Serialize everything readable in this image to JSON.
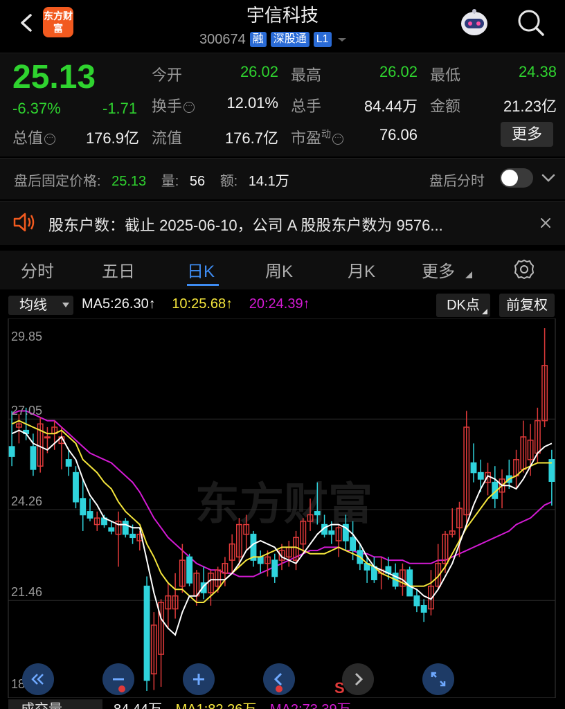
{
  "header": {
    "logo_text": "东方财富",
    "title": "宇信科技",
    "code": "300674",
    "tags": [
      "融",
      "深股通",
      "L1"
    ]
  },
  "quote": {
    "price": "25.13",
    "change_pct": "-6.37%",
    "change": "-1.71",
    "open_label": "今开",
    "open": "26.02",
    "high_label": "最高",
    "high": "26.02",
    "low_label": "最低",
    "low": "24.38",
    "turnover_label": "换手",
    "turnover": "12.01%",
    "volume_label": "总手",
    "volume": "84.44万",
    "amount_label": "金额",
    "amount": "21.23亿",
    "mktcap_label": "总值",
    "mktcap": "176.9亿",
    "float_label": "流值",
    "float_cap": "176.7亿",
    "pe_label": "市盈",
    "pe_sup": "动",
    "pe": "76.06",
    "more_label": "更多"
  },
  "after_hours": {
    "price_label": "盘后固定价格:",
    "price": "25.13",
    "vol_label": "量:",
    "vol": "56",
    "amt_label": "额:",
    "amt": "14.1万",
    "timeshare_label": "盘后分时"
  },
  "notice": {
    "text": "股东户数：截止 2025-06-10，公司 A 股股东户数为 9576..."
  },
  "tabs": [
    "分时",
    "五日",
    "日K",
    "周K",
    "月K",
    "更多"
  ],
  "active_tab": "日K",
  "chart_toolbar": {
    "indicator": "均线",
    "ma5": "MA5:26.30",
    "ma10": "10:25.68",
    "ma20": "20:24.39",
    "dk_label": "DK点",
    "adjust_label": "前复权"
  },
  "volume_strip": {
    "label": "成交量",
    "value": "84.44万",
    "ma1": "MA1:82.26万",
    "ma2": "MA2:73.39万"
  },
  "watermark": "东方财富",
  "colors": {
    "up": "#e03a3a",
    "down": "#2fd3dc",
    "ma5": "#ffffff",
    "ma10": "#f5e63c",
    "ma20": "#d41ad4",
    "accent": "#3e8cf2"
  },
  "chart_data": {
    "type": "candlestick",
    "y_ticks": [
      "29.85",
      "27.05",
      "24.26",
      "21.46",
      "18.67"
    ],
    "ylim": [
      18.67,
      29.85
    ],
    "sell_marker": "S",
    "candles": [
      {
        "o": 26.2,
        "h": 27.3,
        "l": 25.6,
        "c": 25.9
      },
      {
        "o": 26.8,
        "h": 27.2,
        "l": 26.3,
        "c": 26.9
      },
      {
        "o": 26.7,
        "h": 27.4,
        "l": 26.4,
        "c": 26.6
      },
      {
        "o": 26.2,
        "h": 26.6,
        "l": 25.3,
        "c": 25.5
      },
      {
        "o": 25.6,
        "h": 27.1,
        "l": 25.4,
        "c": 26.9
      },
      {
        "o": 26.5,
        "h": 26.8,
        "l": 26.0,
        "c": 26.5
      },
      {
        "o": 26.6,
        "h": 27.0,
        "l": 26.1,
        "c": 26.8
      },
      {
        "o": 26.3,
        "h": 26.8,
        "l": 25.5,
        "c": 26.5
      },
      {
        "o": 25.8,
        "h": 26.1,
        "l": 25.3,
        "c": 25.6
      },
      {
        "o": 25.4,
        "h": 25.6,
        "l": 24.3,
        "c": 24.5
      },
      {
        "o": 24.6,
        "h": 25.2,
        "l": 23.6,
        "c": 24.1
      },
      {
        "o": 24.2,
        "h": 24.6,
        "l": 23.9,
        "c": 24.0
      },
      {
        "o": 23.8,
        "h": 24.2,
        "l": 23.6,
        "c": 24.0
      },
      {
        "o": 24.0,
        "h": 24.1,
        "l": 23.7,
        "c": 23.8
      },
      {
        "o": 23.7,
        "h": 23.9,
        "l": 23.5,
        "c": 23.6
      },
      {
        "o": 23.5,
        "h": 24.2,
        "l": 22.5,
        "c": 23.9
      },
      {
        "o": 23.9,
        "h": 24.0,
        "l": 23.4,
        "c": 23.5
      },
      {
        "o": 23.5,
        "h": 23.8,
        "l": 23.2,
        "c": 23.4
      },
      {
        "o": 23.3,
        "h": 23.6,
        "l": 23.0,
        "c": 23.5
      },
      {
        "o": 21.9,
        "h": 22.2,
        "l": 18.67,
        "c": 19.0
      },
      {
        "o": 19.2,
        "h": 21.1,
        "l": 18.7,
        "c": 20.7
      },
      {
        "o": 19.8,
        "h": 21.5,
        "l": 18.8,
        "c": 21.4
      },
      {
        "o": 21.2,
        "h": 22.0,
        "l": 20.6,
        "c": 21.6
      },
      {
        "o": 21.2,
        "h": 22.3,
        "l": 20.9,
        "c": 21.6
      },
      {
        "o": 21.9,
        "h": 23.2,
        "l": 21.7,
        "c": 22.7
      },
      {
        "o": 22.8,
        "h": 22.9,
        "l": 21.9,
        "c": 22.0
      },
      {
        "o": 21.6,
        "h": 22.4,
        "l": 21.3,
        "c": 22.3
      },
      {
        "o": 22.0,
        "h": 22.5,
        "l": 21.5,
        "c": 21.7
      },
      {
        "o": 21.7,
        "h": 22.4,
        "l": 21.3,
        "c": 22.3
      },
      {
        "o": 21.9,
        "h": 22.5,
        "l": 21.7,
        "c": 22.4
      },
      {
        "o": 22.3,
        "h": 22.8,
        "l": 21.9,
        "c": 22.6
      },
      {
        "o": 22.7,
        "h": 23.5,
        "l": 22.3,
        "c": 23.2
      },
      {
        "o": 22.8,
        "h": 24.0,
        "l": 22.5,
        "c": 23.8
      },
      {
        "o": 23.5,
        "h": 24.1,
        "l": 23.0,
        "c": 23.8
      },
      {
        "o": 23.5,
        "h": 23.6,
        "l": 22.5,
        "c": 22.7
      },
      {
        "o": 22.8,
        "h": 23.0,
        "l": 22.3,
        "c": 22.6
      },
      {
        "o": 22.6,
        "h": 23.0,
        "l": 22.2,
        "c": 22.8
      },
      {
        "o": 22.7,
        "h": 22.9,
        "l": 22.0,
        "c": 22.2
      },
      {
        "o": 22.7,
        "h": 23.2,
        "l": 22.4,
        "c": 23.0
      },
      {
        "o": 22.8,
        "h": 23.3,
        "l": 22.5,
        "c": 23.1
      },
      {
        "o": 22.7,
        "h": 23.6,
        "l": 22.4,
        "c": 23.4
      },
      {
        "o": 23.2,
        "h": 24.0,
        "l": 22.9,
        "c": 23.9
      },
      {
        "o": 23.9,
        "h": 24.6,
        "l": 23.6,
        "c": 24.1
      },
      {
        "o": 24.2,
        "h": 25.1,
        "l": 23.8,
        "c": 24.1
      },
      {
        "o": 23.8,
        "h": 24.1,
        "l": 23.4,
        "c": 23.5
      },
      {
        "o": 23.6,
        "h": 23.9,
        "l": 23.2,
        "c": 23.5
      },
      {
        "o": 23.3,
        "h": 23.8,
        "l": 22.8,
        "c": 23.7
      },
      {
        "o": 23.8,
        "h": 24.1,
        "l": 23.0,
        "c": 23.3
      },
      {
        "o": 23.4,
        "h": 23.9,
        "l": 22.7,
        "c": 23.0
      },
      {
        "o": 23.0,
        "h": 23.2,
        "l": 22.4,
        "c": 22.6
      },
      {
        "o": 22.6,
        "h": 22.8,
        "l": 22.0,
        "c": 22.4
      },
      {
        "o": 22.5,
        "h": 22.8,
        "l": 22.0,
        "c": 22.1
      },
      {
        "o": 22.3,
        "h": 22.8,
        "l": 21.8,
        "c": 22.4
      },
      {
        "o": 22.5,
        "h": 22.8,
        "l": 22.1,
        "c": 22.3
      },
      {
        "o": 22.3,
        "h": 22.6,
        "l": 21.8,
        "c": 21.9
      },
      {
        "o": 21.9,
        "h": 22.6,
        "l": 21.6,
        "c": 22.4
      },
      {
        "o": 22.4,
        "h": 22.5,
        "l": 21.6,
        "c": 21.6
      },
      {
        "o": 21.6,
        "h": 21.8,
        "l": 21.1,
        "c": 21.3
      },
      {
        "o": 21.3,
        "h": 21.5,
        "l": 20.8,
        "c": 21.1
      },
      {
        "o": 21.2,
        "h": 22.4,
        "l": 21.0,
        "c": 21.9
      },
      {
        "o": 21.9,
        "h": 23.2,
        "l": 21.8,
        "c": 22.6
      },
      {
        "o": 22.6,
        "h": 23.6,
        "l": 22.3,
        "c": 23.5
      },
      {
        "o": 23.5,
        "h": 24.3,
        "l": 23.4,
        "c": 23.6
      },
      {
        "o": 23.7,
        "h": 24.5,
        "l": 22.8,
        "c": 24.3
      },
      {
        "o": 24.1,
        "h": 27.3,
        "l": 23.7,
        "c": 26.8
      },
      {
        "o": 25.7,
        "h": 26.3,
        "l": 25.1,
        "c": 25.4
      },
      {
        "o": 25.4,
        "h": 25.8,
        "l": 24.8,
        "c": 25.2
      },
      {
        "o": 25.1,
        "h": 25.7,
        "l": 24.7,
        "c": 25.4
      },
      {
        "o": 25.1,
        "h": 25.6,
        "l": 24.3,
        "c": 24.6
      },
      {
        "o": 24.8,
        "h": 25.5,
        "l": 24.3,
        "c": 25.2
      },
      {
        "o": 25.3,
        "h": 25.8,
        "l": 24.9,
        "c": 25.1
      },
      {
        "o": 25.3,
        "h": 26.1,
        "l": 24.9,
        "c": 25.8
      },
      {
        "o": 25.5,
        "h": 27.0,
        "l": 25.4,
        "c": 26.5
      },
      {
        "o": 25.8,
        "h": 26.9,
        "l": 25.3,
        "c": 26.4
      },
      {
        "o": 26.0,
        "h": 27.4,
        "l": 25.7,
        "c": 27.0
      },
      {
        "o": 27.0,
        "h": 29.85,
        "l": 26.8,
        "c": 28.7
      },
      {
        "o": 25.8,
        "h": 26.1,
        "l": 24.38,
        "c": 25.13
      }
    ],
    "ma5": [
      26.6,
      26.7,
      26.6,
      26.3,
      26.2,
      26.1,
      26.3,
      26.5,
      26.1,
      25.8,
      25.2,
      24.7,
      24.4,
      24.0,
      23.9,
      23.8,
      23.8,
      23.7,
      23.7,
      22.7,
      21.7,
      20.9,
      20.6,
      20.4,
      21.1,
      21.6,
      21.6,
      21.9,
      22.1,
      22.1,
      22.1,
      22.3,
      22.6,
      23.0,
      23.2,
      23.3,
      23.2,
      23.1,
      22.8,
      22.7,
      22.6,
      22.9,
      23.2,
      23.5,
      23.7,
      23.8,
      23.8,
      23.7,
      23.5,
      23.2,
      22.8,
      22.5,
      22.4,
      22.3,
      22.2,
      22.1,
      21.9,
      21.8,
      21.6,
      21.5,
      21.8,
      22.2,
      22.6,
      23.2,
      23.8,
      24.4,
      24.9,
      25.3,
      25.2,
      25.0,
      25.0,
      24.9,
      25.2,
      25.6,
      26.0,
      26.2,
      26.3
    ],
    "ma10": [
      26.9,
      27.0,
      26.9,
      26.8,
      26.7,
      26.6,
      26.6,
      26.7,
      26.5,
      26.3,
      25.8,
      25.6,
      25.4,
      25.1,
      24.9,
      24.5,
      24.2,
      24.0,
      23.8,
      23.2,
      22.8,
      22.3,
      22.0,
      21.8,
      21.8,
      21.6,
      21.4,
      21.4,
      21.6,
      21.8,
      22.1,
      22.3,
      22.5,
      22.7,
      22.8,
      22.8,
      22.9,
      23.0,
      23.1,
      23.1,
      23.1,
      23.0,
      22.9,
      22.9,
      22.9,
      23.0,
      23.1,
      23.0,
      22.9,
      22.8,
      22.6,
      22.5,
      22.3,
      22.2,
      22.1,
      22.0,
      21.9,
      21.9,
      21.9,
      22.0,
      22.2,
      22.5,
      22.9,
      23.3,
      23.7,
      24.0,
      24.3,
      24.6,
      24.8,
      25.0,
      25.2,
      25.3,
      25.5,
      25.6,
      25.7,
      25.7,
      25.7
    ],
    "ma20": [
      27.2,
      27.3,
      27.3,
      27.2,
      27.1,
      27.0,
      27.0,
      26.8,
      26.6,
      26.4,
      26.2,
      26.0,
      25.9,
      25.8,
      25.7,
      25.5,
      25.3,
      25.1,
      24.8,
      24.4,
      24.0,
      23.7,
      23.4,
      23.2,
      23.0,
      22.8,
      22.6,
      22.5,
      22.4,
      22.4,
      22.3,
      22.3,
      22.2,
      22.2,
      22.2,
      22.3,
      22.4,
      22.5,
      22.6,
      22.7,
      22.8,
      22.9,
      23.0,
      23.0,
      23.1,
      23.1,
      23.1,
      23.0,
      23.0,
      22.9,
      22.9,
      22.8,
      22.8,
      22.7,
      22.7,
      22.7,
      22.6,
      22.6,
      22.6,
      22.6,
      22.7,
      22.7,
      22.8,
      22.9,
      23.0,
      23.1,
      23.2,
      23.3,
      23.4,
      23.5,
      23.6,
      23.8,
      23.9,
      24.0,
      24.2,
      24.4,
      24.5
    ]
  }
}
